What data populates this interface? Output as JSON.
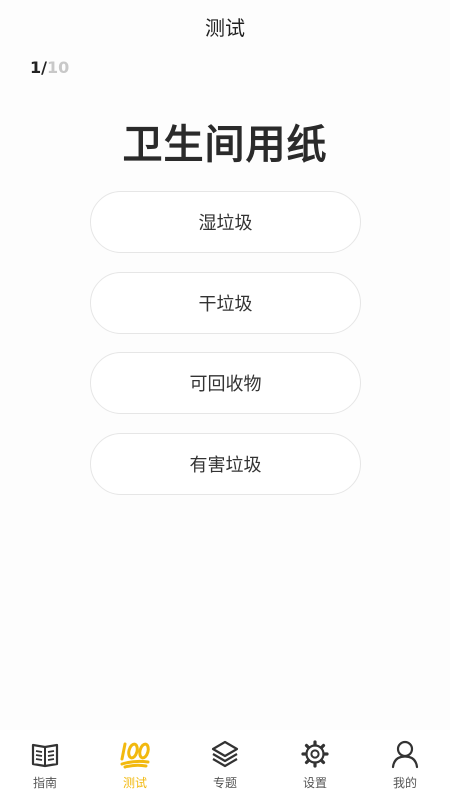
{
  "header": {
    "title": "测试"
  },
  "progress": {
    "current": "1",
    "separator": "/",
    "total": "10"
  },
  "question": {
    "text": "卫生间用纸"
  },
  "options": [
    {
      "label": "湿垃圾"
    },
    {
      "label": "干垃圾"
    },
    {
      "label": "可回收物"
    },
    {
      "label": "有害垃圾"
    }
  ],
  "tabbar": {
    "active_color": "#f2b90f",
    "items": [
      {
        "label": "指南",
        "icon": "book-icon"
      },
      {
        "label": "测试",
        "icon": "hundred-points-icon",
        "active": true
      },
      {
        "label": "专题",
        "icon": "layers-icon"
      },
      {
        "label": "设置",
        "icon": "gear-icon"
      },
      {
        "label": "我的",
        "icon": "user-icon"
      }
    ]
  }
}
